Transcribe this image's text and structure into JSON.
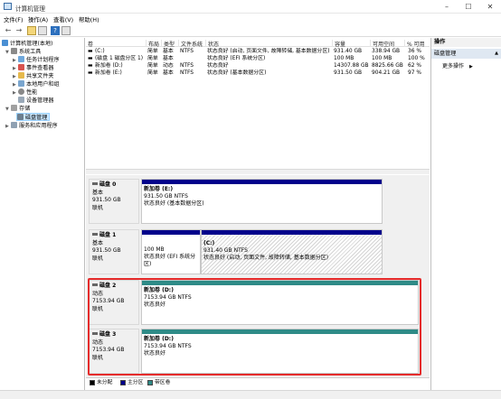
{
  "window": {
    "title": "计算机管理"
  },
  "menu": [
    "文件(F)",
    "操作(A)",
    "查看(V)",
    "帮助(H)"
  ],
  "tree": {
    "root": "计算机管理(本地)",
    "system_tools": "系统工具",
    "task_scheduler": "任务计划程序",
    "event_viewer": "事件查看器",
    "shared_folders": "共享文件夹",
    "local_users": "本地用户和组",
    "performance": "性能",
    "device_manager": "设备管理器",
    "storage": "存储",
    "disk_management": "磁盘管理",
    "services": "服务和应用程序"
  },
  "table": {
    "headers": [
      "卷",
      "布局",
      "类型",
      "文件系统",
      "状态",
      "容量",
      "可用空间",
      "% 可用"
    ],
    "rows": [
      [
        "(C:)",
        "简单",
        "基本",
        "NTFS",
        "状态良好 (启动, 页面文件, 故障转储, 基本数据分区)",
        "931.40 GB",
        "338.94 GB",
        "36 %"
      ],
      [
        "(磁盘 1 磁盘分区 1)",
        "简单",
        "基本",
        "",
        "状态良好 (EFI 系统分区)",
        "100 MB",
        "100 MB",
        "100 %"
      ],
      [
        "新加卷 (D:)",
        "简单",
        "动态",
        "NTFS",
        "状态良好",
        "14307.88 GB",
        "8825.66 GB",
        "62 %"
      ],
      [
        "新加卷 (E:)",
        "简单",
        "基本",
        "NTFS",
        "状态良好 (基本数据分区)",
        "931.50 GB",
        "904.21 GB",
        "97 %"
      ]
    ]
  },
  "disks": [
    {
      "name": "磁盘 0",
      "type": "基本",
      "size": "931.50 GB",
      "state": "联机",
      "parts": [
        {
          "title": "新加卷 (E:)",
          "size": "931.50 GB NTFS",
          "status": "状态良好 (基本数据分区)"
        }
      ]
    },
    {
      "name": "磁盘 1",
      "type": "基本",
      "size": "931.50 GB",
      "state": "联机",
      "parts": [
        {
          "title": "",
          "size": "100 MB",
          "status": "状态良好 (EFI 系统分区)"
        },
        {
          "title": "(C:)",
          "size": "931.40 GB NTFS",
          "status": "状态良好 (启动, 页面文件, 故障转储, 基本数据分区)"
        }
      ]
    },
    {
      "name": "磁盘 2",
      "type": "动态",
      "size": "7153.94 GB",
      "state": "联机",
      "parts": [
        {
          "title": "新加卷 (D:)",
          "size": "7153.94 GB NTFS",
          "status": "状态良好"
        }
      ]
    },
    {
      "name": "磁盘 3",
      "type": "动态",
      "size": "7153.94 GB",
      "state": "联机",
      "parts": [
        {
          "title": "新加卷 (D:)",
          "size": "7153.94 GB NTFS",
          "status": "状态良好"
        }
      ]
    }
  ],
  "legend": [
    "未分配",
    "主分区",
    "带区卷"
  ],
  "actions": {
    "header": "操作",
    "section": "磁盘管理",
    "more": "更多操作"
  },
  "colors": {
    "primary": "#00008b",
    "striped": "#2e8b87",
    "unallocated": "#000000",
    "highlight": "#e52b2b"
  }
}
